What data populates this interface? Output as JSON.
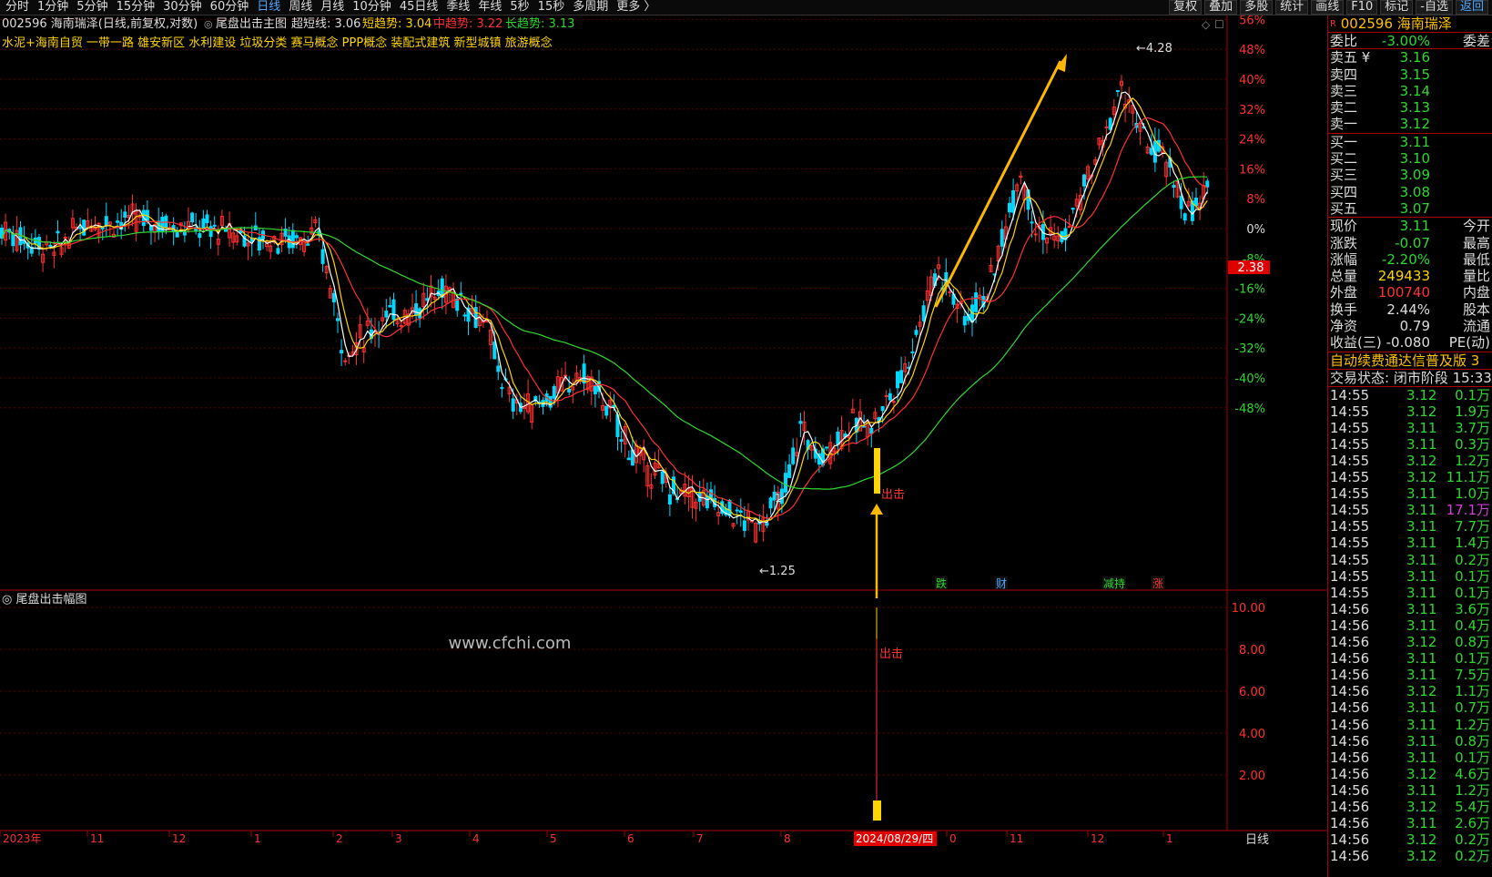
{
  "toolbar": {
    "periods": [
      "分时",
      "1分钟",
      "5分钟",
      "15分钟",
      "30分钟",
      "60分钟",
      "日线",
      "周线",
      "月线",
      "10分钟",
      "45日线",
      "季线",
      "年线",
      "5秒",
      "15秒",
      "多周期",
      "更多 〉"
    ],
    "active_period": "日线",
    "buttons": [
      "复权",
      "叠加",
      "多股",
      "统计",
      "画线",
      "F10",
      "标记",
      "-自选",
      "返回"
    ]
  },
  "main_panel": {
    "stock_title": "002596 海南瑞泽(日线,前复权,对数)",
    "indicator_name": "尾盘出击主图",
    "indicators": [
      {
        "label": "超短线: 3.06",
        "color": "#dddddd"
      },
      {
        "label": "短趋势: 3.04",
        "color": "#ffd400"
      },
      {
        "label": "中趋势: 3.22",
        "color": "#ff3030"
      },
      {
        "label": "长趋势: 3.13",
        "color": "#2fd82f"
      }
    ],
    "concepts": "水泥+海南自贸 一带一路 雄安新区 水利建设 垃圾分类 赛马概念 PPP概念 装配式建筑 新型城镇 旅游概念",
    "price_axis": [
      "56%",
      "48%",
      "40%",
      "32%",
      "24%",
      "16%",
      "8%",
      "0%",
      "-8%",
      "-16%",
      "-24%",
      "-32%",
      "-40%",
      "-48%"
    ],
    "current_price_tag": "2.38",
    "high_label": "4.28",
    "low_label": "1.25",
    "signal_label": "出击",
    "event_tags": [
      {
        "label": "跌",
        "color": "#2fd82f"
      },
      {
        "label": "财",
        "color": "#4da6ff"
      },
      {
        "label": "减持",
        "color": "#2fd82f"
      },
      {
        "label": "涨",
        "color": "#ff3030"
      }
    ],
    "mark_1": "1"
  },
  "sub_panel": {
    "title": "尾盘出击幅图",
    "watermark": "www.cfchi.com",
    "axis": [
      "10.00",
      "8.00",
      "6.00",
      "4.00",
      "2.00"
    ],
    "signal_label": "出击"
  },
  "x_axis": {
    "labels": [
      "2023年",
      "11",
      "12",
      "1",
      "2",
      "3",
      "4",
      "5",
      "6",
      "7",
      "8",
      "2024/08/29/四",
      "0",
      "11",
      "12",
      "1"
    ],
    "period": "日线"
  },
  "chart_data": {
    "type": "candlestick",
    "series": [
      {
        "name": "超短线",
        "value": 3.06,
        "color": "#ffffff"
      },
      {
        "name": "短趋势",
        "value": 3.04,
        "color": "#ffd400"
      },
      {
        "name": "中趋势",
        "value": 3.22,
        "color": "#ff3030"
      },
      {
        "name": "长趋势",
        "value": 3.13,
        "color": "#2fd82f"
      }
    ],
    "high": 4.28,
    "low": 1.25,
    "current_price_tag": 2.38,
    "signal_date": "2024/08/29/四",
    "signal_value": 10.0,
    "y_percent_range": [
      -48,
      56
    ]
  },
  "quote": {
    "code": "002596",
    "name": "海南瑞泽",
    "wei_bi_label": "委比",
    "wei_bi": "-3.00%",
    "wei_cha_label": "委差",
    "sell": [
      {
        "label": "卖五 ¥",
        "price": "3.16"
      },
      {
        "label": "卖四",
        "price": "3.15"
      },
      {
        "label": "卖三",
        "price": "3.14"
      },
      {
        "label": "卖二",
        "price": "3.13"
      },
      {
        "label": "卖一",
        "price": "3.12"
      }
    ],
    "buy": [
      {
        "label": "买一",
        "price": "3.11"
      },
      {
        "label": "买二",
        "price": "3.10"
      },
      {
        "label": "买三",
        "price": "3.09"
      },
      {
        "label": "买四",
        "price": "3.08"
      },
      {
        "label": "买五",
        "price": "3.07"
      }
    ],
    "stats": [
      {
        "l": "现价",
        "v": "3.11",
        "vc": "green",
        "r": "今开"
      },
      {
        "l": "涨跌",
        "v": "-0.07",
        "vc": "green",
        "r": "最高"
      },
      {
        "l": "涨幅",
        "v": "-2.20%",
        "vc": "green",
        "r": "最低"
      },
      {
        "l": "总量",
        "v": "249433",
        "vc": "yellow",
        "r": "量比"
      },
      {
        "l": "外盘",
        "v": "100740",
        "vc": "red",
        "r": "内盘"
      },
      {
        "l": "换手",
        "v": "2.44%",
        "vc": "white",
        "r": "股本"
      },
      {
        "l": "净资",
        "v": "0.79",
        "vc": "white",
        "r": "流通"
      },
      {
        "l": "收益(三)",
        "v": "-0.080",
        "vc": "white",
        "r": "PE(动)"
      }
    ],
    "banner": "自动续费通达信普及版 3",
    "trade_status": "交易状态: 闭市阶段 15:33"
  },
  "ticks": [
    {
      "t": "14:55",
      "p": "3.12",
      "v": "0.1万",
      "c": "#2fd82f"
    },
    {
      "t": "14:55",
      "p": "3.12",
      "v": "1.9万",
      "c": "#2fd82f"
    },
    {
      "t": "14:55",
      "p": "3.11",
      "v": "3.7万",
      "c": "#2fd82f"
    },
    {
      "t": "14:55",
      "p": "3.11",
      "v": "0.3万",
      "c": "#2fd82f"
    },
    {
      "t": "14:55",
      "p": "3.12",
      "v": "1.2万",
      "c": "#2fd82f"
    },
    {
      "t": "14:55",
      "p": "3.12",
      "v": "11.1万",
      "c": "#2fd82f"
    },
    {
      "t": "14:55",
      "p": "3.11",
      "v": "1.0万",
      "c": "#2fd82f"
    },
    {
      "t": "14:55",
      "p": "3.11",
      "v": "17.1万",
      "c": "#d73cd7"
    },
    {
      "t": "14:55",
      "p": "3.11",
      "v": "7.7万",
      "c": "#2fd82f"
    },
    {
      "t": "14:55",
      "p": "3.11",
      "v": "1.4万",
      "c": "#2fd82f"
    },
    {
      "t": "14:55",
      "p": "3.11",
      "v": "0.2万",
      "c": "#2fd82f"
    },
    {
      "t": "14:55",
      "p": "3.11",
      "v": "0.1万",
      "c": "#2fd82f"
    },
    {
      "t": "14:55",
      "p": "3.11",
      "v": "0.1万",
      "c": "#2fd82f"
    },
    {
      "t": "14:56",
      "p": "3.11",
      "v": "3.6万",
      "c": "#2fd82f"
    },
    {
      "t": "14:56",
      "p": "3.11",
      "v": "0.4万",
      "c": "#2fd82f"
    },
    {
      "t": "14:56",
      "p": "3.12",
      "v": "0.8万",
      "c": "#2fd82f"
    },
    {
      "t": "14:56",
      "p": "3.11",
      "v": "0.1万",
      "c": "#2fd82f"
    },
    {
      "t": "14:56",
      "p": "3.11",
      "v": "7.5万",
      "c": "#2fd82f"
    },
    {
      "t": "14:56",
      "p": "3.12",
      "v": "1.1万",
      "c": "#2fd82f"
    },
    {
      "t": "14:56",
      "p": "3.11",
      "v": "0.7万",
      "c": "#2fd82f"
    },
    {
      "t": "14:56",
      "p": "3.11",
      "v": "1.2万",
      "c": "#2fd82f"
    },
    {
      "t": "14:56",
      "p": "3.11",
      "v": "0.8万",
      "c": "#2fd82f"
    },
    {
      "t": "14:56",
      "p": "3.11",
      "v": "0.1万",
      "c": "#2fd82f"
    },
    {
      "t": "14:56",
      "p": "3.12",
      "v": "4.6万",
      "c": "#2fd82f"
    },
    {
      "t": "14:56",
      "p": "3.11",
      "v": "1.2万",
      "c": "#2fd82f"
    },
    {
      "t": "14:56",
      "p": "3.12",
      "v": "5.4万",
      "c": "#2fd82f"
    },
    {
      "t": "14:56",
      "p": "3.11",
      "v": "2.6万",
      "c": "#2fd82f"
    },
    {
      "t": "14:56",
      "p": "3.12",
      "v": "0.2万",
      "c": "#2fd82f"
    },
    {
      "t": "14:56",
      "p": "3.12",
      "v": "0.2万",
      "c": "#2fd82f"
    }
  ]
}
